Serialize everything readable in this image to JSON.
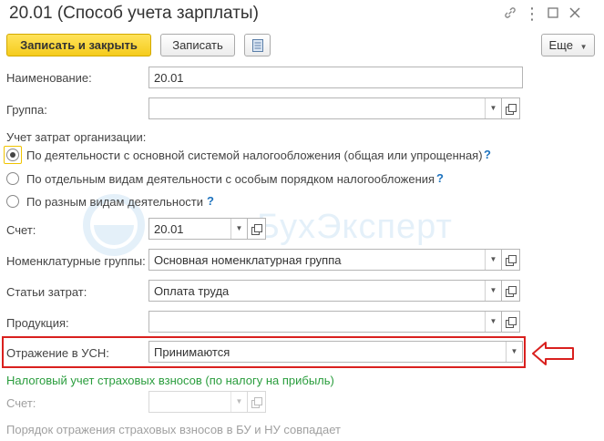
{
  "window": {
    "title": "20.01 (Способ учета зарплаты)"
  },
  "toolbar": {
    "save_close_label": "Записать и закрыть",
    "save_label": "Записать",
    "more_label": "Еще"
  },
  "fields": {
    "name_label": "Наименование:",
    "name_value": "20.01",
    "group_label": "Группа:",
    "group_value": "",
    "cost_type_label": "Учет затрат организации:",
    "radios": [
      {
        "label": "По деятельности с основной системой налогообложения (общая или упрощенная)",
        "selected": true
      },
      {
        "label": "По отдельным видам деятельности с особым порядком налогообложения",
        "selected": false
      },
      {
        "label": "По разным видам деятельности",
        "selected": false
      }
    ],
    "help_mark": "?",
    "account_label": "Счет:",
    "account_value": "20.01",
    "nomenclature_label": "Номенклатурные группы:",
    "nomenclature_value": "Основная номенклатурная группа",
    "cost_items_label": "Статьи затрат:",
    "cost_items_value": "Оплата труда",
    "products_label": "Продукция:",
    "products_value": "",
    "usn_label": "Отражение в УСН:",
    "usn_value": "Принимаются",
    "insurance_heading": "Налоговый учет страховых взносов (по налогу на прибыль)",
    "insurance_account_label": "Счет:",
    "insurance_account_value": "",
    "footer_note": "Порядок отражения страховых взносов в БУ и НУ совпадает"
  },
  "watermark": "БухЭксперт",
  "colors": {
    "primary_button": "#f5cc1d",
    "highlight_border": "#d9201e",
    "arrow": "#d9201e",
    "help": "#1e73be",
    "green_heading": "#2a9d3d"
  }
}
